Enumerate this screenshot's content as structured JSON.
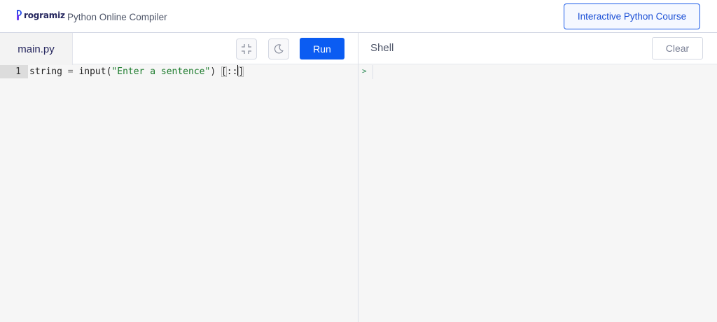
{
  "header": {
    "logo_text": "rogramiz",
    "app_title": "Python Online Compiler",
    "course_button": "Interactive Python Course"
  },
  "editor": {
    "file_tab": "main.py",
    "run_label": "Run",
    "icons": {
      "collapse": "collapse-icon",
      "theme": "moon-icon"
    },
    "lines": [
      {
        "number": "1",
        "tokens": {
          "ident": "string",
          "assign": " = ",
          "call": "input(",
          "str": "\"Enter a sentence\"",
          "close": ") ",
          "open_bracket": "[",
          "slice": "::",
          "close_bracket": "]"
        }
      }
    ]
  },
  "shell": {
    "title": "Shell",
    "clear_label": "Clear",
    "prompt": ">"
  },
  "colors": {
    "accent": "#0b5cf2",
    "string": "#1a7a2a",
    "prompt": "#2e8b57"
  }
}
